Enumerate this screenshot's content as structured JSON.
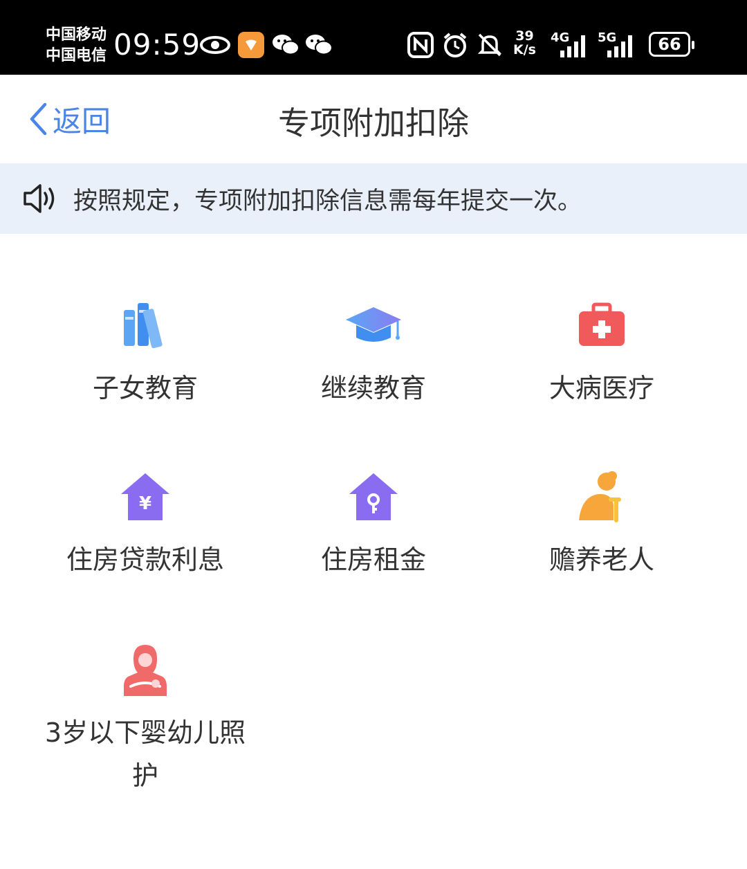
{
  "status_bar": {
    "carrier_1": "中国移动",
    "carrier_2": "中国电信",
    "time": "09:59",
    "net_speed_value": "39",
    "net_speed_unit": "K/s",
    "signal_1": "4G",
    "signal_2": "5G",
    "battery": "66",
    "icons": [
      "eye-icon",
      "app-badge-icon",
      "wechat-icon",
      "wechat-icon",
      "nfc-icon",
      "alarm-icon",
      "mute-icon",
      "signal-icon",
      "signal-icon",
      "battery-icon"
    ]
  },
  "header": {
    "back_label": "返回",
    "title": "专项附加扣除"
  },
  "notice": {
    "text": "按照规定，专项附加扣除信息需每年提交一次。"
  },
  "items": [
    {
      "label": "子女教育",
      "icon": "books-icon"
    },
    {
      "label": "继续教育",
      "icon": "graduation-cap-icon"
    },
    {
      "label": "大病医疗",
      "icon": "medical-kit-icon"
    },
    {
      "label": "住房贷款利息",
      "icon": "house-yen-icon"
    },
    {
      "label": "住房租金",
      "icon": "house-key-icon"
    },
    {
      "label": "赡养老人",
      "icon": "elderly-icon"
    },
    {
      "label": "3岁以下婴幼儿照护",
      "label_line1": "3岁以下婴幼儿照",
      "label_line2": "护",
      "icon": "mother-baby-icon"
    }
  ],
  "colors": {
    "accent_blue": "#4a86e8",
    "notice_bg": "#e9f0fa",
    "purple": "#8a6cf0",
    "red": "#f05a5a",
    "orange": "#f7a63c"
  }
}
